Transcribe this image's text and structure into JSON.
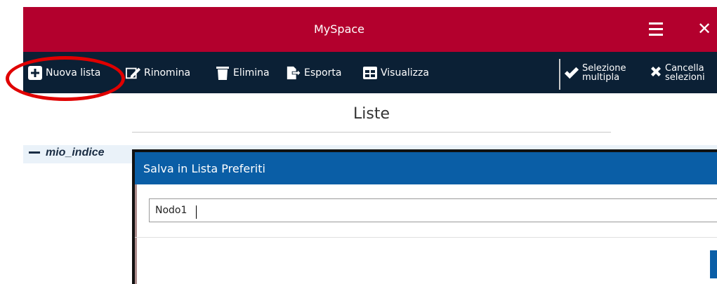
{
  "app": {
    "title": "MySpace"
  },
  "toolbar": {
    "new_list": "Nuova lista",
    "rename": "Rinomina",
    "delete": "Elimina",
    "export": "Esporta",
    "view": "Visualizza",
    "multi_select_line1": "Selezione",
    "multi_select_line2": "multipla",
    "clear_line1": "Cancella",
    "clear_line2": "selezioni"
  },
  "page": {
    "heading": "Liste"
  },
  "tree": {
    "node_label": "mio_indice"
  },
  "dialog": {
    "title": "Salva in Lista Preferiti",
    "input_value": "Nodo1"
  },
  "colors": {
    "titlebar": "#b3002d",
    "toolbar": "#0b2035",
    "dialog_header": "#0a5ea6",
    "annotation": "#e00000"
  },
  "icons": {
    "menu": "hamburger-icon",
    "close": "close-icon",
    "new_list": "plus-square-icon",
    "rename": "edit-icon",
    "delete": "trash-icon",
    "export": "export-icon",
    "view": "grid-icon",
    "multi_select": "double-check-icon",
    "clear": "x-icon"
  }
}
